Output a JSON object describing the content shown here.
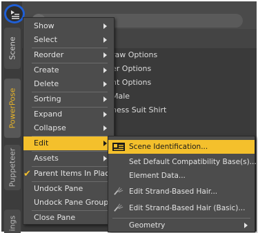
{
  "tabs": {
    "scene": "Scene",
    "powerpose": "PowerPose",
    "puppeteer": "Puppeteer",
    "settings": "ings"
  },
  "background_items": [
    "raw Options",
    "er Options",
    "nt Options",
    "Male",
    "ness Suit Shirt"
  ],
  "menu": {
    "items": [
      {
        "label": "Show",
        "submenu": true
      },
      {
        "label": "Select",
        "submenu": true
      },
      {
        "label": "Reorder",
        "submenu": true
      },
      {
        "label": "Create",
        "submenu": true
      },
      {
        "label": "Delete",
        "submenu": true
      },
      {
        "label": "Sorting",
        "submenu": true
      },
      {
        "label": "Expand",
        "submenu": true
      },
      {
        "label": "Collapse",
        "submenu": true
      },
      {
        "label": "Edit",
        "submenu": true,
        "active": true
      },
      {
        "label": "Assets",
        "submenu": true
      },
      {
        "label": "Parent Items In Place",
        "checked": true
      },
      {
        "label": "Undock Pane"
      },
      {
        "label": "Undock Pane Group"
      },
      {
        "label": "Close Pane"
      }
    ]
  },
  "submenu": {
    "items": [
      {
        "label": "Scene Identification...",
        "icon": "scene-id-icon",
        "active": true
      },
      {
        "label": "Set Default Compatibility Base(s)..."
      },
      {
        "label": "Element Data..."
      },
      {
        "label": "Edit Strand-Based Hair...",
        "icon": "hair-brush-icon"
      },
      {
        "label": "Edit Strand-Based Hair (Basic)...",
        "icon": "hair-brush-icon"
      },
      {
        "label": "Geometry",
        "submenu": true
      }
    ]
  },
  "colors": {
    "highlight": "#f4c02c",
    "menu_bg": "#4c4c4c",
    "powerpose_tab": "#e8b428",
    "focus_ring": "#1f5fd6"
  }
}
